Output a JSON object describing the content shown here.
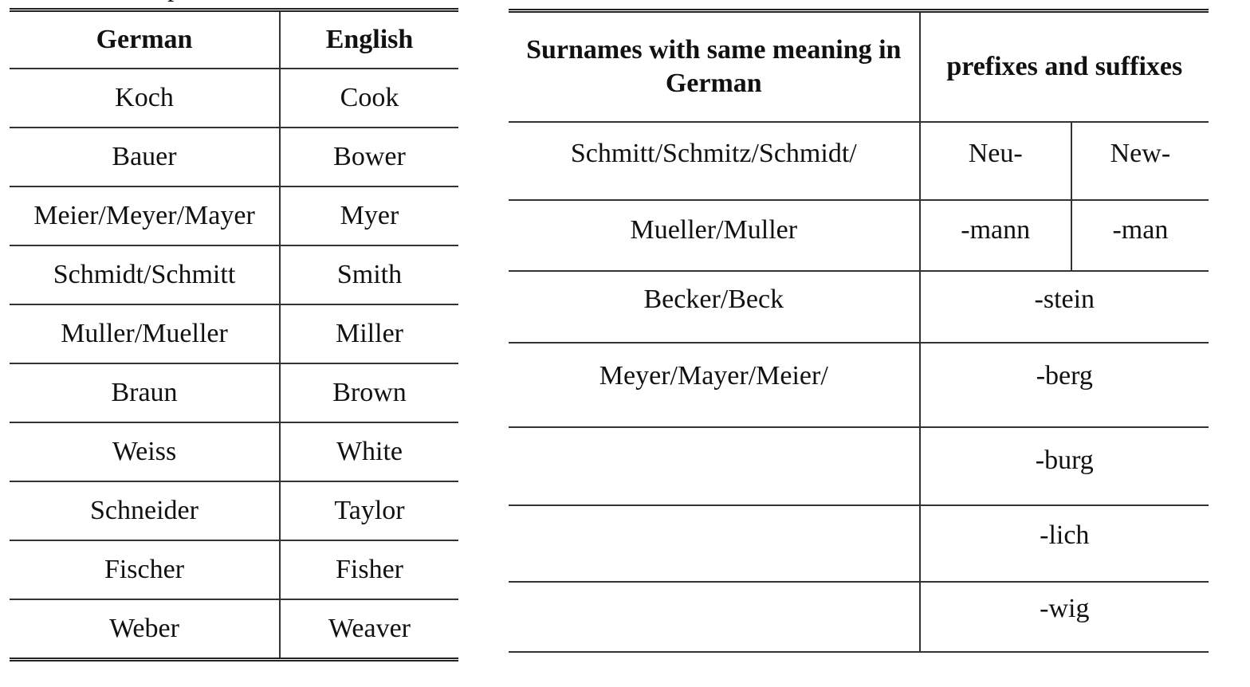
{
  "cutoff_text": "p",
  "left_table": {
    "headers": [
      "German",
      "English"
    ],
    "rows": [
      [
        "Koch",
        "Cook"
      ],
      [
        "Bauer",
        "Bower"
      ],
      [
        "Meier/Meyer/Mayer",
        "Myer"
      ],
      [
        "Schmidt/Schmitt",
        "Smith"
      ],
      [
        "Muller/Mueller",
        "Miller"
      ],
      [
        "Braun",
        "Brown"
      ],
      [
        "Weiss",
        "White"
      ],
      [
        "Schneider",
        "Taylor"
      ],
      [
        "Fischer",
        "Fisher"
      ],
      [
        "Weber",
        "Weaver"
      ]
    ]
  },
  "right_table": {
    "headers": {
      "col1": "Surnames with same meaning in German",
      "col2": "prefixes and suffixes"
    },
    "rows": [
      {
        "name": "Schmitt/Schmitz/Schmidt/",
        "a": "Neu-",
        "b": "New-"
      },
      {
        "name": "Mueller/Muller",
        "a": "-mann",
        "b": "-man"
      },
      {
        "name": "Becker/Beck",
        "affix": "-stein"
      },
      {
        "name": "Meyer/Mayer/Meier/",
        "affix": "-berg"
      },
      {
        "name": "",
        "affix": "-burg"
      },
      {
        "name": "",
        "affix": "-lich"
      },
      {
        "name": "",
        "affix": "-wig"
      }
    ]
  }
}
